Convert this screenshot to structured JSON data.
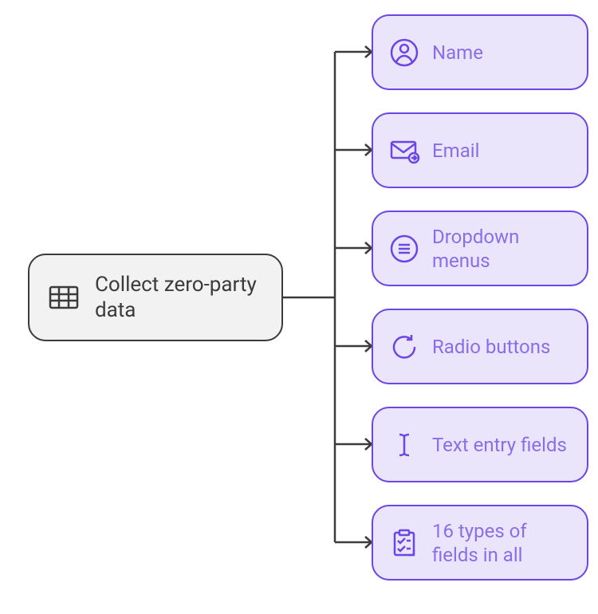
{
  "root": {
    "label": "Collect zero-party data",
    "icon": "table-icon"
  },
  "children": [
    {
      "label": "Name",
      "icon": "user-icon"
    },
    {
      "label": "Email",
      "icon": "mail-forward-icon"
    },
    {
      "label": "Dropdown menus",
      "icon": "list-circle-icon"
    },
    {
      "label": "Radio buttons",
      "icon": "refresh-icon"
    },
    {
      "label": "Text entry fields",
      "icon": "text-cursor-icon"
    },
    {
      "label": "16 types of fields in all",
      "icon": "checklist-icon"
    }
  ],
  "colors": {
    "root_border": "#3b3b3b",
    "root_bg": "#f2f2f2",
    "child_border": "#6b46e5",
    "child_bg": "#ebe5fc",
    "child_text": "#8a6ee8",
    "connector": "#3b3b3b"
  }
}
